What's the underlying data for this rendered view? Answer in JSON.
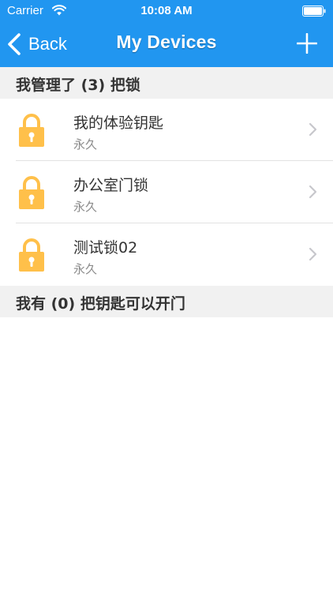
{
  "status_bar": {
    "carrier": "Carrier",
    "time": "10:08 AM",
    "wifi_icon": "wifi-icon",
    "battery_icon": "battery-full-icon"
  },
  "nav_bar": {
    "back_label": "Back",
    "title": "My Devices",
    "add_icon": "plus-icon",
    "background_color": "#2196f0"
  },
  "sections": {
    "managed": {
      "header": "我管理了 (3) 把锁",
      "locks": [
        {
          "name": "我的体验钥匙",
          "validity": "永久"
        },
        {
          "name": "办公室门锁",
          "validity": "永久"
        },
        {
          "name": "测试锁02",
          "validity": "永久"
        }
      ]
    },
    "keys": {
      "header": "我有 (0) 把钥匙可以开门"
    }
  },
  "colors": {
    "lock_body": "#ffc04a",
    "section_bg": "#f1f1f1",
    "chevron": "#c7c7cc"
  }
}
